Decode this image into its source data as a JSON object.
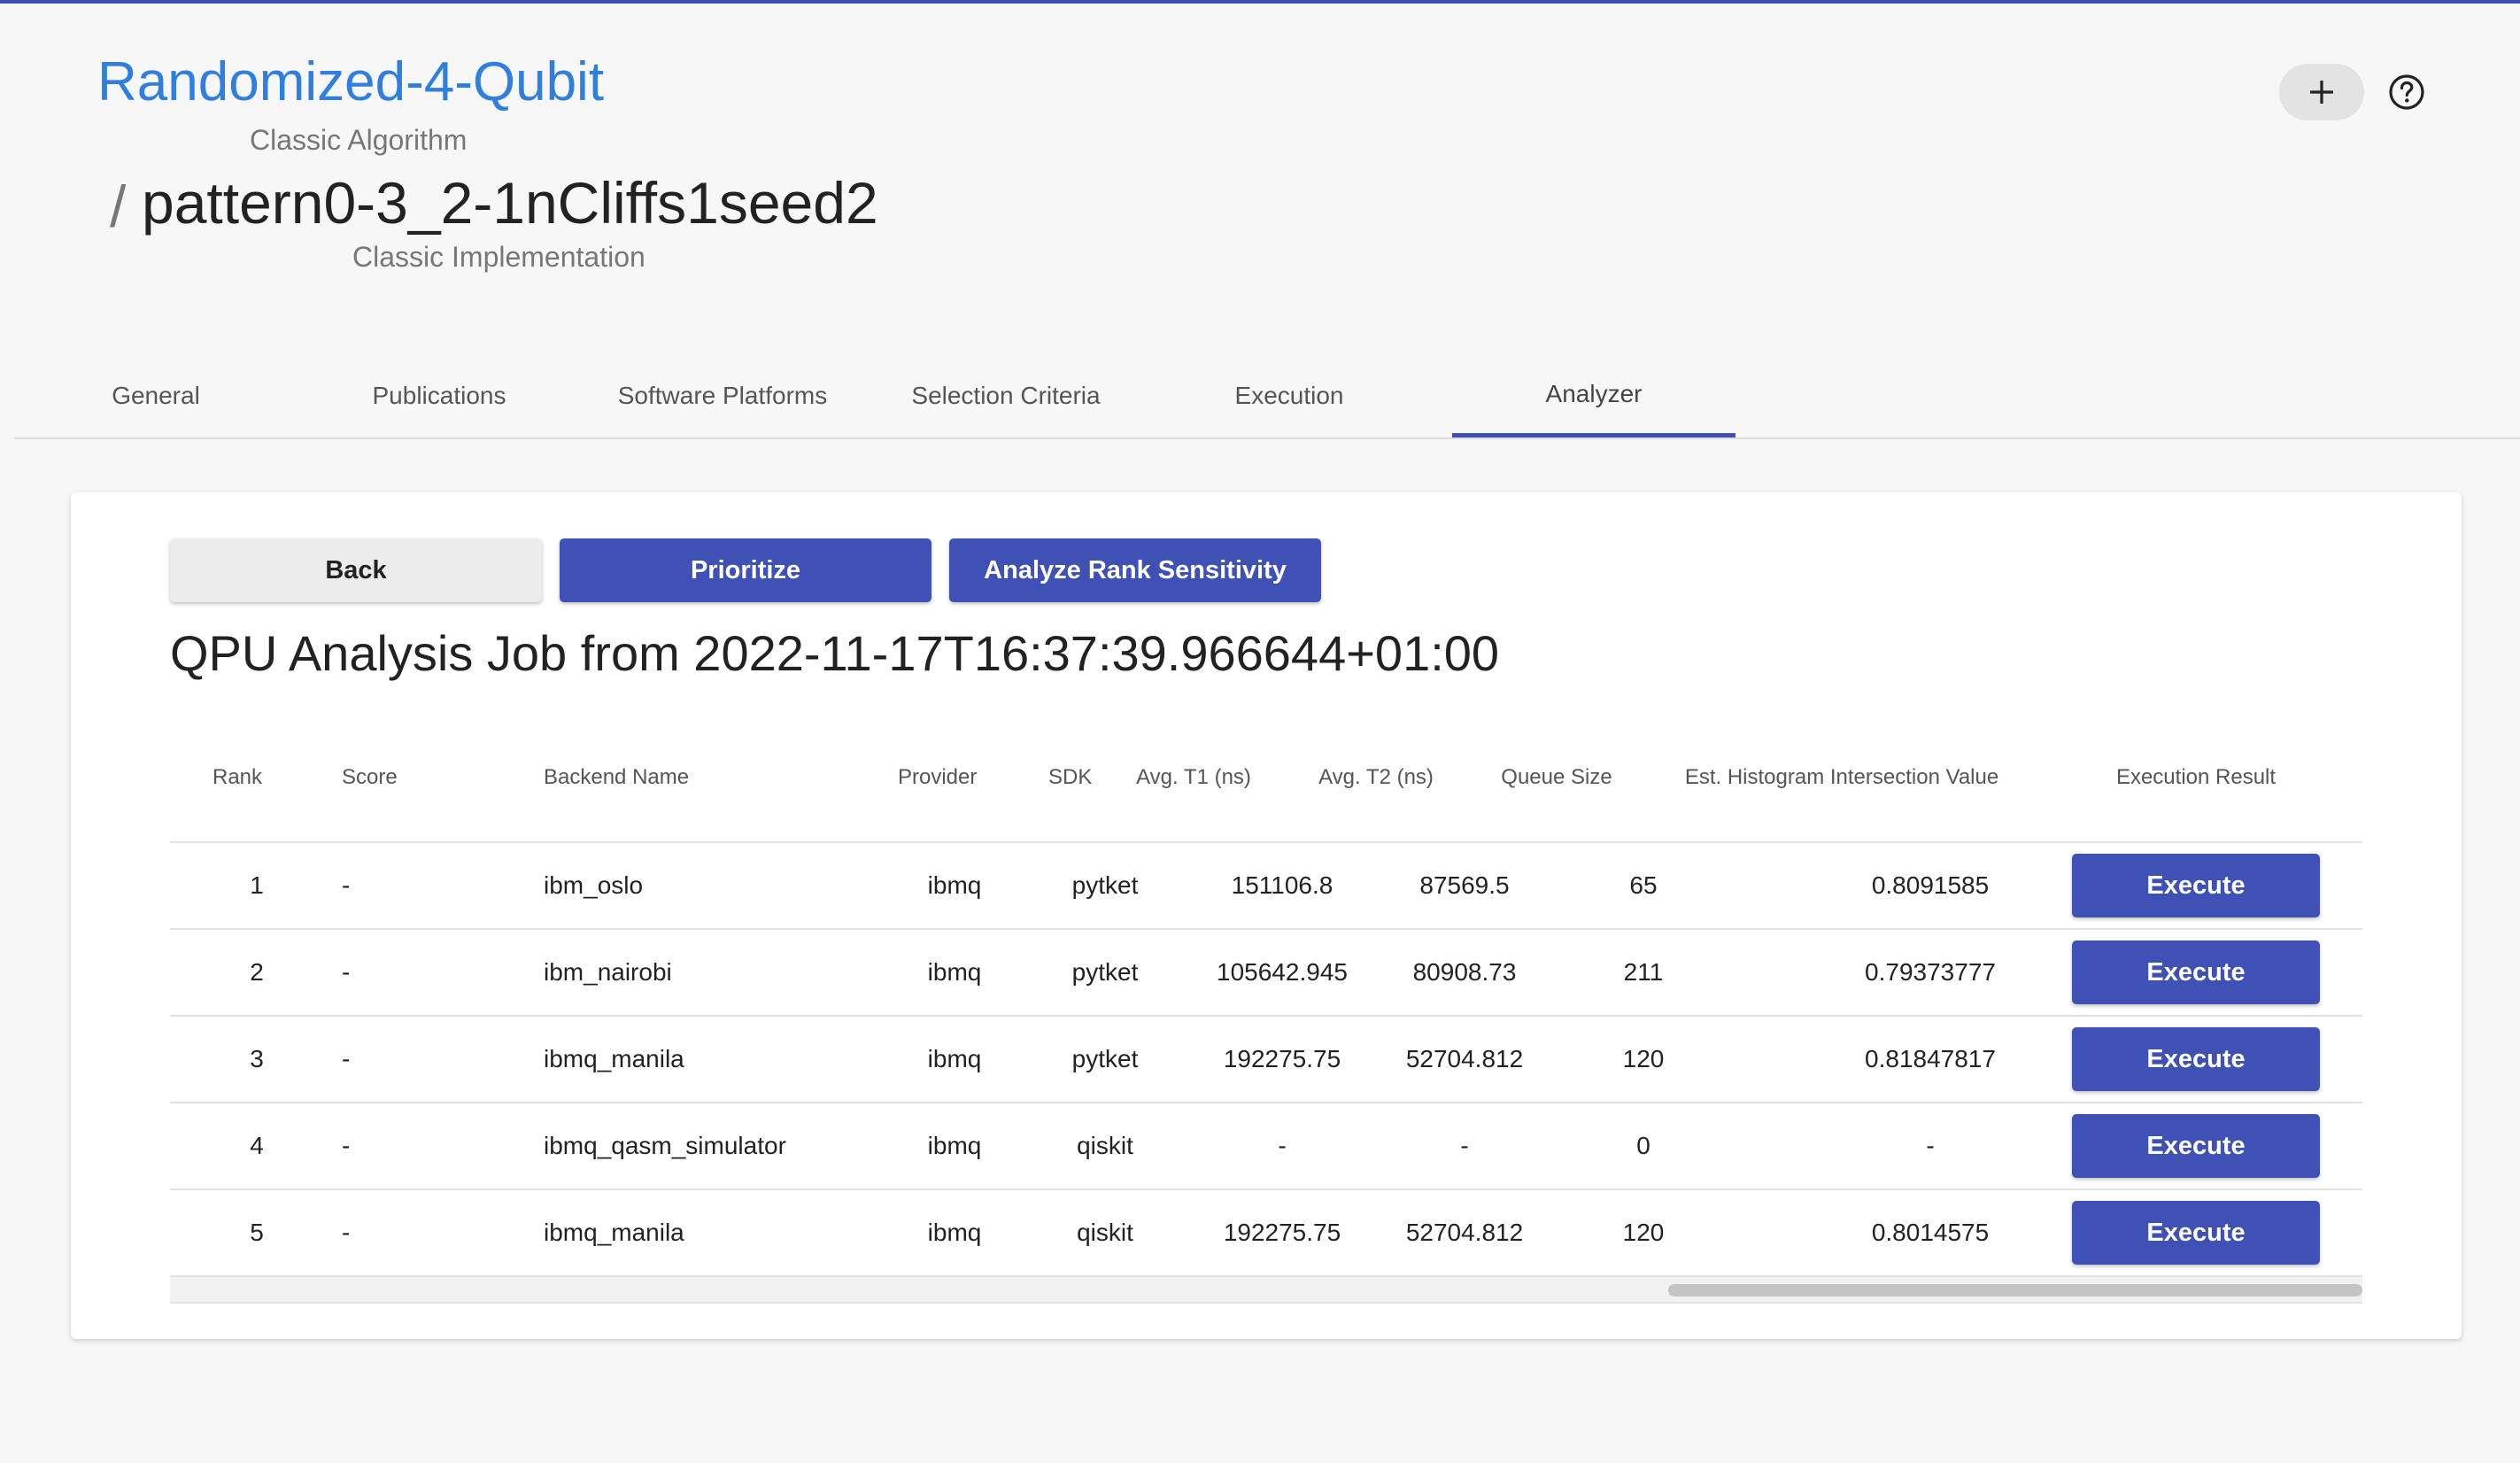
{
  "header": {
    "algorithm_name": "Randomized-4-Qubit",
    "algorithm_type": "Classic Algorithm",
    "separator": "/",
    "implementation_name": "pattern0-3_2-1nCliffs1seed2",
    "implementation_type": "Classic Implementation",
    "add_icon": "plus-icon",
    "help_icon": "help-circle-icon"
  },
  "tabs": [
    {
      "label": "General",
      "active": false
    },
    {
      "label": "Publications",
      "active": false
    },
    {
      "label": "Software Platforms",
      "active": false
    },
    {
      "label": "Selection Criteria",
      "active": false
    },
    {
      "label": "Execution",
      "active": false
    },
    {
      "label": "Analyzer",
      "active": true
    }
  ],
  "toolbar": {
    "back_label": "Back",
    "prioritize_label": "Prioritize",
    "rank_sensitivity_label": "Analyze Rank Sensitivity"
  },
  "job": {
    "title": "QPU Analysis Job from 2022-11-17T16:37:39.966644+01:00"
  },
  "table": {
    "columns": [
      "Rank",
      "Score",
      "Backend Name",
      "Provider",
      "SDK",
      "Avg. T1 (ns)",
      "Avg. T2 (ns)",
      "Queue Size",
      "Est. Histogram Intersection Value",
      "Execution Result"
    ],
    "rows": [
      {
        "rank": "1",
        "score": "-",
        "backend": "ibm_oslo",
        "provider": "ibmq",
        "sdk": "pytket",
        "t1": "151106.8",
        "t2": "87569.5",
        "queue": "65",
        "hist": "0.8091585",
        "action": "Execute"
      },
      {
        "rank": "2",
        "score": "-",
        "backend": "ibm_nairobi",
        "provider": "ibmq",
        "sdk": "pytket",
        "t1": "105642.945",
        "t2": "80908.73",
        "queue": "211",
        "hist": "0.79373777",
        "action": "Execute"
      },
      {
        "rank": "3",
        "score": "-",
        "backend": "ibmq_manila",
        "provider": "ibmq",
        "sdk": "pytket",
        "t1": "192275.75",
        "t2": "52704.812",
        "queue": "120",
        "hist": "0.81847817",
        "action": "Execute"
      },
      {
        "rank": "4",
        "score": "-",
        "backend": "ibmq_qasm_simulator",
        "provider": "ibmq",
        "sdk": "qiskit",
        "t1": "-",
        "t2": "-",
        "queue": "0",
        "hist": "-",
        "action": "Execute"
      },
      {
        "rank": "5",
        "score": "-",
        "backend": "ibmq_manila",
        "provider": "ibmq",
        "sdk": "qiskit",
        "t1": "192275.75",
        "t2": "52704.812",
        "queue": "120",
        "hist": "0.8014575",
        "action": "Execute"
      }
    ]
  },
  "colors": {
    "accent": "#3f51b5",
    "title_link": "#2f7fe0"
  }
}
